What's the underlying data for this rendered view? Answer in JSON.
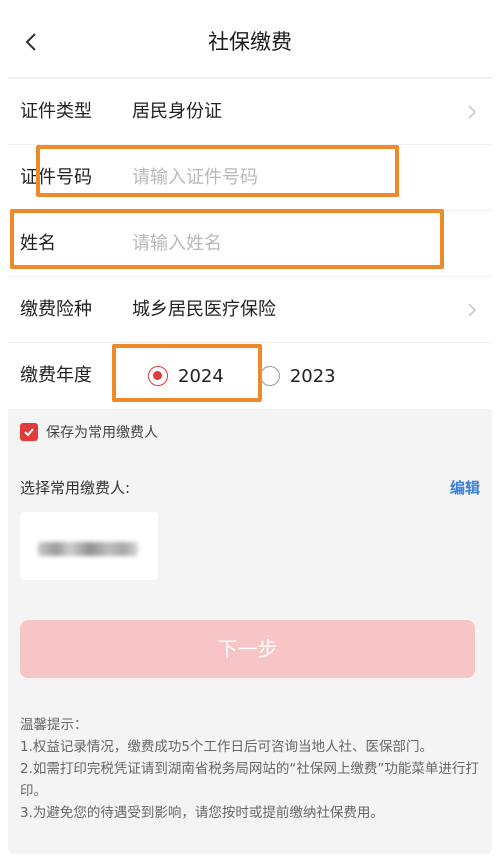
{
  "header": {
    "title": "社保缴费"
  },
  "form": {
    "id_type": {
      "label": "证件类型",
      "value": "居民身份证"
    },
    "id_number": {
      "label": "证件号码",
      "placeholder": "请输入证件号码"
    },
    "name": {
      "label": "姓名",
      "placeholder": "请输入姓名"
    },
    "insurance": {
      "label": "缴费险种",
      "value": "城乡居民医疗保险"
    },
    "year": {
      "label": "缴费年度",
      "options": [
        {
          "label": "2024",
          "checked": true
        },
        {
          "label": "2023",
          "checked": false
        }
      ]
    }
  },
  "save_payer": {
    "label": "保存为常用缴费人",
    "checked": true
  },
  "payer_list": {
    "title": "选择常用缴费人:",
    "edit_label": "编辑"
  },
  "next_button": {
    "label": "下一步"
  },
  "tips": {
    "title": "温馨提示：",
    "items": [
      "1.权益记录情况，缴费成功5个工作日后可咨询当地人社、医保部门。",
      "2.如需打印完税凭证请到湖南省税务局网站的“社保网上缴费”功能菜单进行打印。",
      "3.为避免您的待遇受到影响，请您按时或提前缴纳社保费用。"
    ]
  },
  "colors": {
    "accent": "#e23a3a",
    "highlight": "#ef8a2b",
    "link": "#3a82d8",
    "button_disabled": "#f7c5c5"
  }
}
